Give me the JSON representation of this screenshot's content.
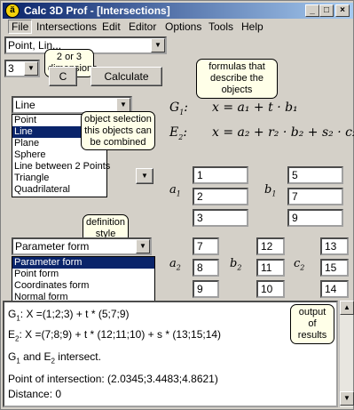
{
  "window": {
    "title": "Calc 3D Prof - [Intersections]",
    "app_icon": "ä",
    "controls": [
      "_",
      "□",
      "×"
    ]
  },
  "menu": [
    "File",
    "Intersections",
    "Edit",
    "Editor",
    "Options",
    "Tools",
    "Help"
  ],
  "top_combo": {
    "value": "Point, Lin..."
  },
  "dimensions": {
    "value": "3",
    "callout": "2 or 3 dimensions"
  },
  "buttons": {
    "c": "C",
    "calculate": "Calculate"
  },
  "object_combo": {
    "value": "Line"
  },
  "object_list": [
    "Point",
    "Line",
    "Plane",
    "Sphere",
    "Line between 2 Points",
    "Triangle",
    "Quadrilateral"
  ],
  "object_list_selected": 1,
  "callouts": {
    "formulas": "formulas that describe the objects",
    "object_selection": "object selection this objects can be combined",
    "definition": "definition style",
    "output": "output of results"
  },
  "formulas": {
    "g1_label": "G",
    "g1_sub": "1",
    "g1_eq": "x = a₁ + t · b₁",
    "e2_label": "E",
    "e2_sub": "2",
    "e2_eq": "x = a₂ + r₂ · b₂ + s₂ · c₂"
  },
  "form_combo": {
    "value": "Parameter form"
  },
  "form_list": [
    "Parameter form",
    "Point form",
    "Coordinates form",
    "Normal form"
  ],
  "form_list_selected": 0,
  "vector_labels": {
    "a1": "a",
    "a1sub": "1",
    "b1": "b",
    "b1sub": "1",
    "a2": "a",
    "a2sub": "2",
    "b2": "b",
    "b2sub": "2",
    "c2": "c",
    "c2sub": "2"
  },
  "vectors": {
    "a1": [
      "1",
      "2",
      "3"
    ],
    "b1": [
      "5",
      "7",
      "9"
    ],
    "a2": [
      "7",
      "8",
      "9"
    ],
    "b2": [
      "12",
      "11",
      "10"
    ],
    "c2": [
      "13",
      "15",
      "14"
    ]
  },
  "output": {
    "line1_pre": "G",
    "line1_sub": "1",
    "line1": ": X =(1;2;3) + t * (5;7;9)",
    "line2_pre": "E",
    "line2_sub": "2",
    "line2": ": X =(7;8;9) + t * (12;11;10) + s * (13;15;14)",
    "line3_a": "G",
    "line3_asub": "1",
    "line3_mid": " and E",
    "line3_bsub": "2",
    "line3_end": " intersect.",
    "line4": "Point of intersection: (2.0345;3.4483;4.8621)",
    "line5": "Distance: 0"
  }
}
